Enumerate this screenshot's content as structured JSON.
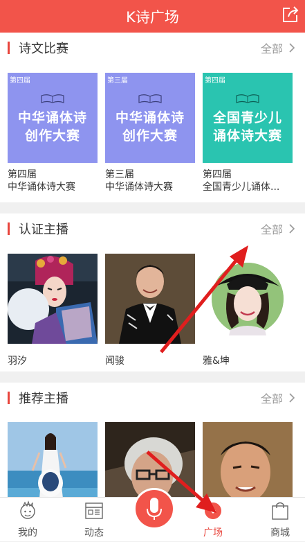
{
  "header": {
    "title": "K诗广场"
  },
  "sections": [
    {
      "title": "诗文比赛",
      "more": "全部",
      "cards": [
        {
          "edition": "第四届",
          "poster_line1": "中华诵体诗",
          "poster_line2": "创作大赛",
          "cap1": "第四届",
          "cap2": "中华诵体诗大赛",
          "color": "#8e94ef"
        },
        {
          "edition": "第三届",
          "poster_line1": "中华诵体诗",
          "poster_line2": "创作大赛",
          "cap1": "第三届",
          "cap2": "中华诵体诗大赛",
          "color": "#8e94ef"
        },
        {
          "edition": "第四届",
          "poster_line1": "全国青少儿",
          "poster_line2": "诵体诗大赛",
          "cap1": "第四届",
          "cap2": "全国青少儿诵体...",
          "color": "#2ac4b0"
        }
      ]
    },
    {
      "title": "认证主播",
      "more": "全部",
      "hosts": [
        {
          "name": "羽汐"
        },
        {
          "name": "闻骏"
        },
        {
          "name": "雅&坤"
        }
      ]
    },
    {
      "title": "推荐主播",
      "more": "全部"
    }
  ],
  "nav": [
    {
      "label": "我的",
      "icon": "avatar-icon"
    },
    {
      "label": "动态",
      "icon": "news-icon"
    },
    {
      "label": "",
      "icon": "microphone-icon"
    },
    {
      "label": "广场",
      "icon": "square-icon"
    },
    {
      "label": "商城",
      "icon": "shopping-bag-icon"
    }
  ],
  "colors": {
    "accent": "#f2544a",
    "poster_blue": "#8e94ef",
    "poster_teal": "#2ac4b0"
  }
}
